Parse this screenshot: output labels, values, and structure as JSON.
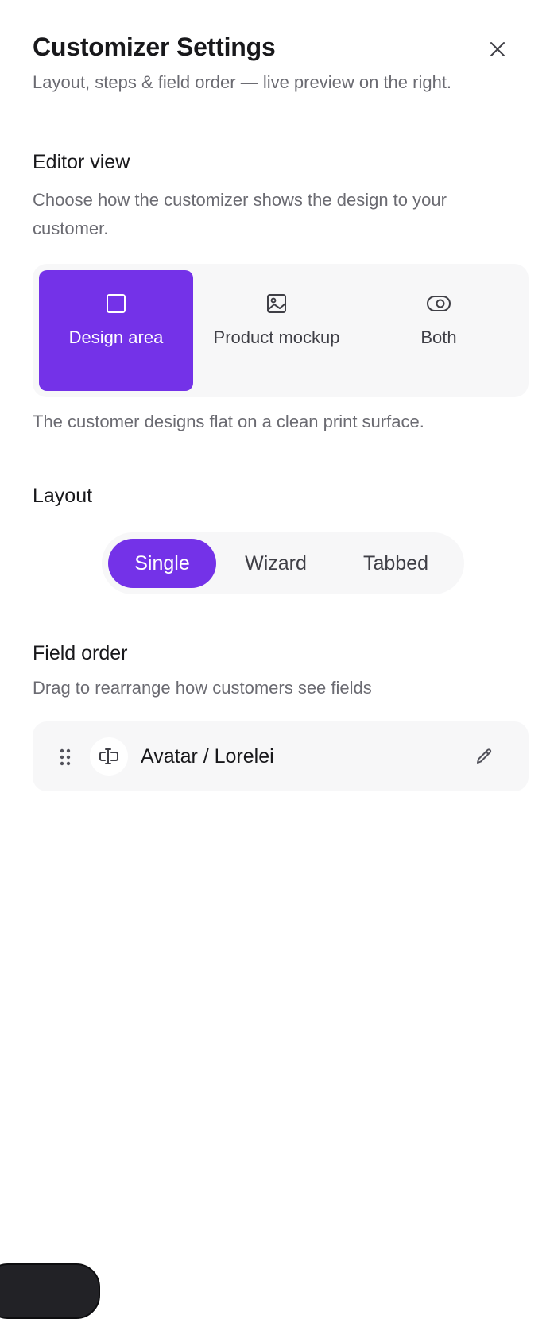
{
  "header": {
    "title": "Customizer Settings",
    "subtitle": "Layout, steps & field order — live preview on the right.",
    "close_icon": "close-icon"
  },
  "editor_view": {
    "title": "Editor view",
    "description": "Choose how the customizer shows the design to your customer.",
    "options": [
      {
        "label": "Design area",
        "icon": "square-icon",
        "selected": true
      },
      {
        "label": "Product mockup",
        "icon": "image-icon",
        "selected": false
      },
      {
        "label": "Both",
        "icon": "eye-icon",
        "selected": false
      }
    ],
    "note": "The customer designs flat on a clean print surface."
  },
  "layout": {
    "title": "Layout",
    "options": [
      {
        "label": "Single",
        "selected": true
      },
      {
        "label": "Wizard",
        "selected": false
      },
      {
        "label": "Tabbed",
        "selected": false
      }
    ]
  },
  "field_order": {
    "title": "Field order",
    "description": "Drag to rearrange how customers see fields",
    "fields": [
      {
        "label": "Avatar / Lorelei",
        "icon": "text-field-icon",
        "action_icon": "pencil-icon"
      }
    ]
  },
  "colors": {
    "accent": "#7432e8",
    "surface": "#f7f7f8",
    "muted_text": "#6b6b72",
    "text": "#18181b"
  }
}
